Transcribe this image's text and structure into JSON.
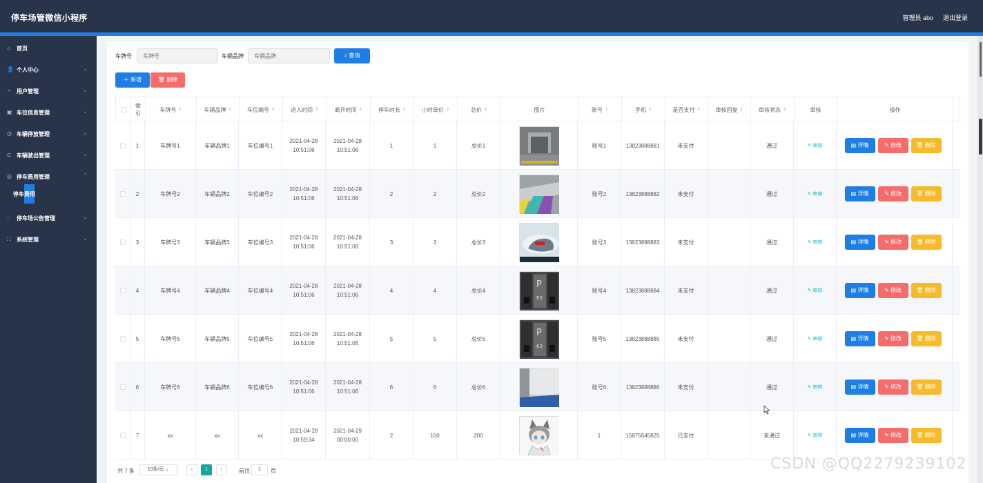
{
  "header": {
    "title": "停车场管微信小程序",
    "user": "管理员 abo",
    "logout": "退出登录"
  },
  "sidebar": {
    "items": [
      {
        "label": "首页",
        "icon": "home-icon"
      },
      {
        "label": "个人中心",
        "icon": "user-icon"
      },
      {
        "label": "用户管理",
        "icon": "users-icon"
      },
      {
        "label": "车位信息管理",
        "icon": "parking-icon"
      },
      {
        "label": "车辆停放管理",
        "icon": "clock-icon"
      },
      {
        "label": "车辆驶出管理",
        "icon": "exit-icon"
      },
      {
        "label": "停车费用管理",
        "icon": "fee-icon"
      },
      {
        "label": "停车场公告管理",
        "icon": "notice-icon"
      },
      {
        "label": "系统管理",
        "icon": "settings-icon"
      }
    ],
    "subitem": "停车费用"
  },
  "search": {
    "plate_label": "车牌号",
    "plate_placeholder": "车牌号",
    "brand_label": "车辆品牌",
    "brand_placeholder": "车辆品牌",
    "query_button": "查询"
  },
  "actions": {
    "add": "新增",
    "delete": "删除"
  },
  "table": {
    "headers": [
      "索引",
      "车牌号",
      "车辆品牌",
      "车位编号",
      "进入时间",
      "离开时间",
      "停车时长",
      "小时单价",
      "总价",
      "图片",
      "账号",
      "手机",
      "是否支付",
      "审核回复",
      "审核状态",
      "审核",
      "操作"
    ],
    "rows": [
      {
        "idx": "1",
        "plate": "车牌号1",
        "brand": "车辆品牌1",
        "spot": "车位编号1",
        "in": "2021-04-28 10:51:06",
        "out": "2021-04-28 10:51:06",
        "dur": "1",
        "price": "1",
        "total": "总价1",
        "acct": "账号1",
        "phone": "13823888881",
        "paid": "未支付",
        "reply": "",
        "status": "通过",
        "img": "garage"
      },
      {
        "idx": "2",
        "plate": "车牌号2",
        "brand": "车辆品牌2",
        "spot": "车位编号2",
        "in": "2021-04-28 10:51:06",
        "out": "2021-04-28 10:51:06",
        "dur": "2",
        "price": "2",
        "total": "总价2",
        "acct": "账号2",
        "phone": "13823888882",
        "paid": "未支付",
        "reply": "",
        "status": "通过",
        "img": "colorful"
      },
      {
        "idx": "3",
        "plate": "车牌号3",
        "brand": "车辆品牌3",
        "spot": "车位编号3",
        "in": "2021-04-28 10:51:06",
        "out": "2021-04-28 10:51:06",
        "dur": "3",
        "price": "3",
        "total": "总价3",
        "acct": "账号3",
        "phone": "13823888883",
        "paid": "未支付",
        "reply": "",
        "status": "通过",
        "img": "car"
      },
      {
        "idx": "4",
        "plate": "车牌号4",
        "brand": "车辆品牌4",
        "spot": "车位编号4",
        "in": "2021-04-28 10:51:06",
        "out": "2021-04-28 10:51:06",
        "dur": "4",
        "price": "4",
        "total": "总价4",
        "acct": "账号4",
        "phone": "13823888884",
        "paid": "未支付",
        "reply": "",
        "status": "通过",
        "img": "spot"
      },
      {
        "idx": "5",
        "plate": "车牌号5",
        "brand": "车辆品牌5",
        "spot": "车位编号5",
        "in": "2021-04-28 10:51:06",
        "out": "2021-04-28 10:51:06",
        "dur": "5",
        "price": "5",
        "total": "总价5",
        "acct": "账号5",
        "phone": "13823888885",
        "paid": "未支付",
        "reply": "",
        "status": "通过",
        "img": "spot"
      },
      {
        "idx": "6",
        "plate": "车牌号6",
        "brand": "车辆品牌6",
        "spot": "车位编号6",
        "in": "2021-04-28 10:51:06",
        "out": "2021-04-28 10:51:06",
        "dur": "6",
        "price": "6",
        "total": "总价6",
        "acct": "账号6",
        "phone": "13823888886",
        "paid": "未支付",
        "reply": "",
        "status": "通过",
        "img": "blue"
      },
      {
        "idx": "7",
        "plate": "xx",
        "brand": "xx",
        "spot": "xx",
        "in": "2021-04-28 10:59:34",
        "out": "2021-04-29 00:00:00",
        "dur": "2",
        "price": "100",
        "total": "200",
        "acct": "1",
        "phone": "15875645825",
        "paid": "已支付",
        "reply": "",
        "status": "未通过",
        "img": "anime"
      }
    ],
    "audit_label": "审核",
    "detail_label": "详情",
    "edit_label": "修改",
    "remove_label": "删除"
  },
  "pagination": {
    "total": "共 7 条",
    "page_size": "10条/页",
    "current": "1",
    "goto_prefix": "前往",
    "goto_value": "1",
    "goto_suffix": "页"
  },
  "watermark": "CSDN @QQ2279239102",
  "colors": {
    "topbar": "#28344a",
    "accent": "#1e7ee6",
    "danger": "#f56c6c",
    "warning": "#f7ba2a",
    "audit": "#13c2c2"
  }
}
